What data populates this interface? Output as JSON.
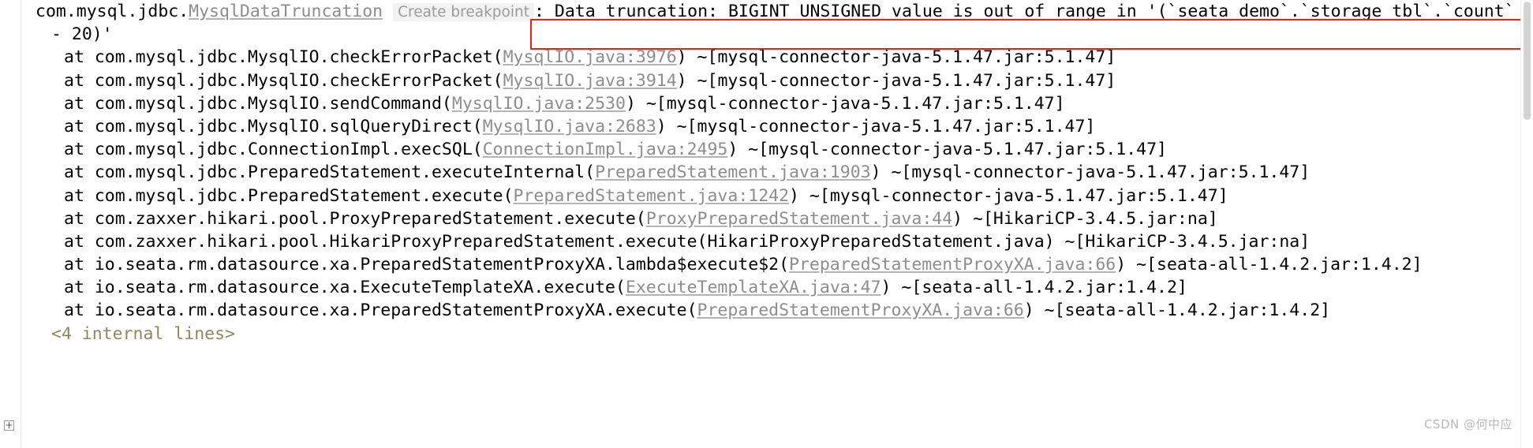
{
  "console": {
    "exception": {
      "package_prefix": "com.mysql.jdbc.",
      "class_link": "MysqlDataTruncation",
      "breakpoint_hint": "Create breakpoint",
      "message_line1": ": Data truncation: BIGINT UNSIGNED value is out of range in '(`seata_demo`.`storage_tbl`.`count`",
      "message_line2": "- 20)'"
    },
    "frames": [
      {
        "prefix": "at com.mysql.jdbc.MysqlIO.checkErrorPacket(",
        "link": "MysqlIO.java:3976",
        "suffix": ") ~[mysql-connector-java-5.1.47.jar:5.1.47]"
      },
      {
        "prefix": "at com.mysql.jdbc.MysqlIO.checkErrorPacket(",
        "link": "MysqlIO.java:3914",
        "suffix": ") ~[mysql-connector-java-5.1.47.jar:5.1.47]"
      },
      {
        "prefix": "at com.mysql.jdbc.MysqlIO.sendCommand(",
        "link": "MysqlIO.java:2530",
        "suffix": ") ~[mysql-connector-java-5.1.47.jar:5.1.47]"
      },
      {
        "prefix": "at com.mysql.jdbc.MysqlIO.sqlQueryDirect(",
        "link": "MysqlIO.java:2683",
        "suffix": ") ~[mysql-connector-java-5.1.47.jar:5.1.47]"
      },
      {
        "prefix": "at com.mysql.jdbc.ConnectionImpl.execSQL(",
        "link": "ConnectionImpl.java:2495",
        "suffix": ") ~[mysql-connector-java-5.1.47.jar:5.1.47]"
      },
      {
        "prefix": "at com.mysql.jdbc.PreparedStatement.executeInternal(",
        "link": "PreparedStatement.java:1903",
        "suffix": ") ~[mysql-connector-java-5.1.47.jar:5.1.47]"
      },
      {
        "prefix": "at com.mysql.jdbc.PreparedStatement.execute(",
        "link": "PreparedStatement.java:1242",
        "suffix": ") ~[mysql-connector-java-5.1.47.jar:5.1.47]"
      },
      {
        "prefix": "at com.zaxxer.hikari.pool.ProxyPreparedStatement.execute(",
        "link": "ProxyPreparedStatement.java:44",
        "suffix": ") ~[HikariCP-3.4.5.jar:na]"
      },
      {
        "prefix": "at com.zaxxer.hikari.pool.HikariProxyPreparedStatement.execute(HikariProxyPreparedStatement.java",
        "link": "",
        "suffix": ") ~[HikariCP-3.4.5.jar:na]"
      },
      {
        "prefix": "at io.seata.rm.datasource.xa.PreparedStatementProxyXA.lambda$execute$2(",
        "link": "PreparedStatementProxyXA.java:66",
        "suffix": ") ~[seata-all-1.4.2.jar:1.4.2]"
      },
      {
        "prefix": "at io.seata.rm.datasource.xa.ExecuteTemplateXA.execute(",
        "link": "ExecuteTemplateXA.java:47",
        "suffix": ") ~[seata-all-1.4.2.jar:1.4.2]"
      },
      {
        "prefix": "at io.seata.rm.datasource.xa.PreparedStatementProxyXA.execute(",
        "link": "PreparedStatementProxyXA.java:66",
        "suffix": ") ~[seata-all-1.4.2.jar:1.4.2]"
      }
    ],
    "internal_lines_label": "<4 internal lines>",
    "fold_toggle_label": "+",
    "highlight_color": "#e8201a"
  },
  "watermark": {
    "text": "CSDN @何中应"
  }
}
